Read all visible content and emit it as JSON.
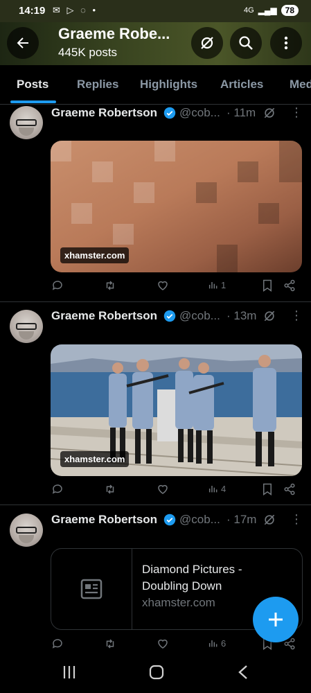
{
  "status_bar": {
    "time": "14:19",
    "network": "4G",
    "battery": "78"
  },
  "header": {
    "title": "Graeme Robe...",
    "subtitle": "445K posts"
  },
  "tabs": [
    {
      "label": "Posts",
      "active": true
    },
    {
      "label": "Replies",
      "active": false
    },
    {
      "label": "Highlights",
      "active": false
    },
    {
      "label": "Articles",
      "active": false
    },
    {
      "label": "Med",
      "active": false
    }
  ],
  "posts": [
    {
      "name": "Graeme Robertson",
      "handle": "@cob...",
      "time": "· 11m",
      "media_type": "blurred-image",
      "media_label": "xhamster.com",
      "views": "1"
    },
    {
      "name": "Graeme Robertson",
      "handle": "@cob...",
      "time": "· 13m",
      "media_type": "photo-soldiers-pier",
      "media_label": "xhamster.com",
      "views": "4"
    },
    {
      "name": "Graeme Robertson",
      "handle": "@cob...",
      "time": "· 17m",
      "media_type": "link-card",
      "card_title": "Diamond Pictures - Doubling Down",
      "card_domain": "xhamster.com",
      "views": "6"
    }
  ],
  "icons": [
    "back-arrow-icon",
    "grok-icon",
    "search-icon",
    "more-vert-icon",
    "verified-badge-icon",
    "reply-icon",
    "repost-icon",
    "like-icon",
    "views-icon",
    "bookmark-icon",
    "share-icon",
    "article-icon",
    "compose-plus-icon"
  ],
  "colors": {
    "accent": "#1d9bf0",
    "background": "#000000",
    "secondary_text": "#71767b"
  }
}
